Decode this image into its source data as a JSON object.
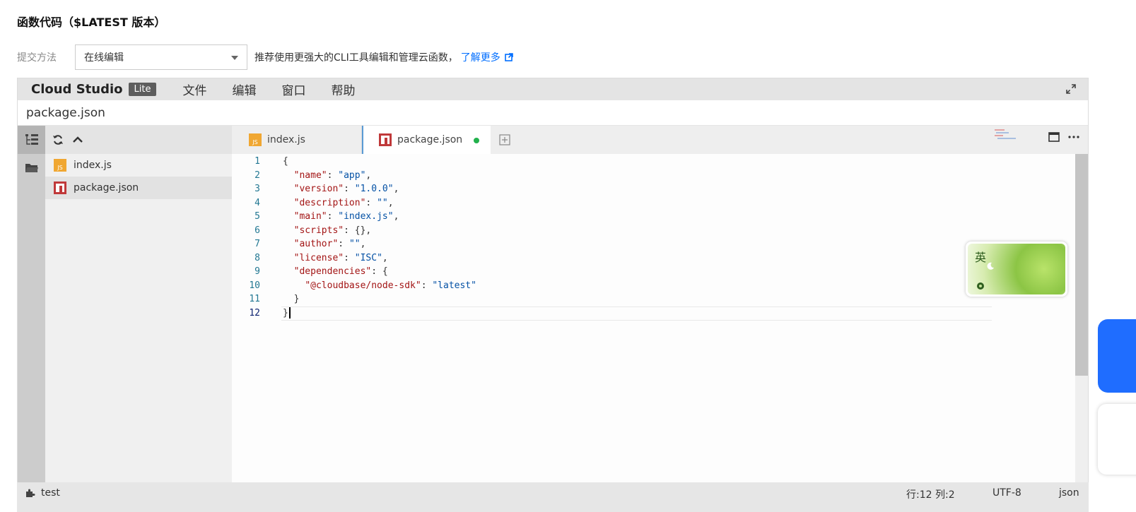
{
  "page": {
    "title": "函数代码（$LATEST 版本）"
  },
  "submit": {
    "label": "提交方法",
    "selected": "在线编辑",
    "hint": "推荐使用更强大的CLI工具编辑和管理云函数，",
    "learn_more": "了解更多"
  },
  "ide": {
    "brand": "Cloud Studio",
    "badge": "Lite",
    "menu": [
      "文件",
      "编辑",
      "窗口",
      "帮助"
    ],
    "path": "package.json",
    "files": [
      {
        "name": "index.js",
        "icon": "js-file-icon"
      },
      {
        "name": "package.json",
        "icon": "npm-file-icon"
      }
    ],
    "tabs": [
      {
        "name": "index.js",
        "icon": "js-file-icon"
      },
      {
        "name": "package.json",
        "icon": "npm-file-icon",
        "unsaved": true
      }
    ],
    "code_lines": [
      "{",
      "  \"name\": \"app\",",
      "  \"version\": \"1.0.0\",",
      "  \"description\": \"\",",
      "  \"main\": \"index.js\",",
      "  \"scripts\": {},",
      "  \"author\": \"\",",
      "  \"license\": \"ISC\",",
      "  \"dependencies\": {",
      "    \"@cloudbase/node-sdk\": \"latest\"",
      "  }",
      "}"
    ],
    "current_line": 12
  },
  "ime": {
    "char": "英"
  },
  "status": {
    "env": "test",
    "position": "行:12 列:2",
    "encoding": "UTF-8",
    "language": "json"
  },
  "colors": {
    "accent": "#006eff",
    "menubar": "#e4e4e4",
    "json_key": "#a31515",
    "json_string": "#0451a5",
    "line_number": "#237893",
    "unsaved_dot": "#22b14c"
  }
}
